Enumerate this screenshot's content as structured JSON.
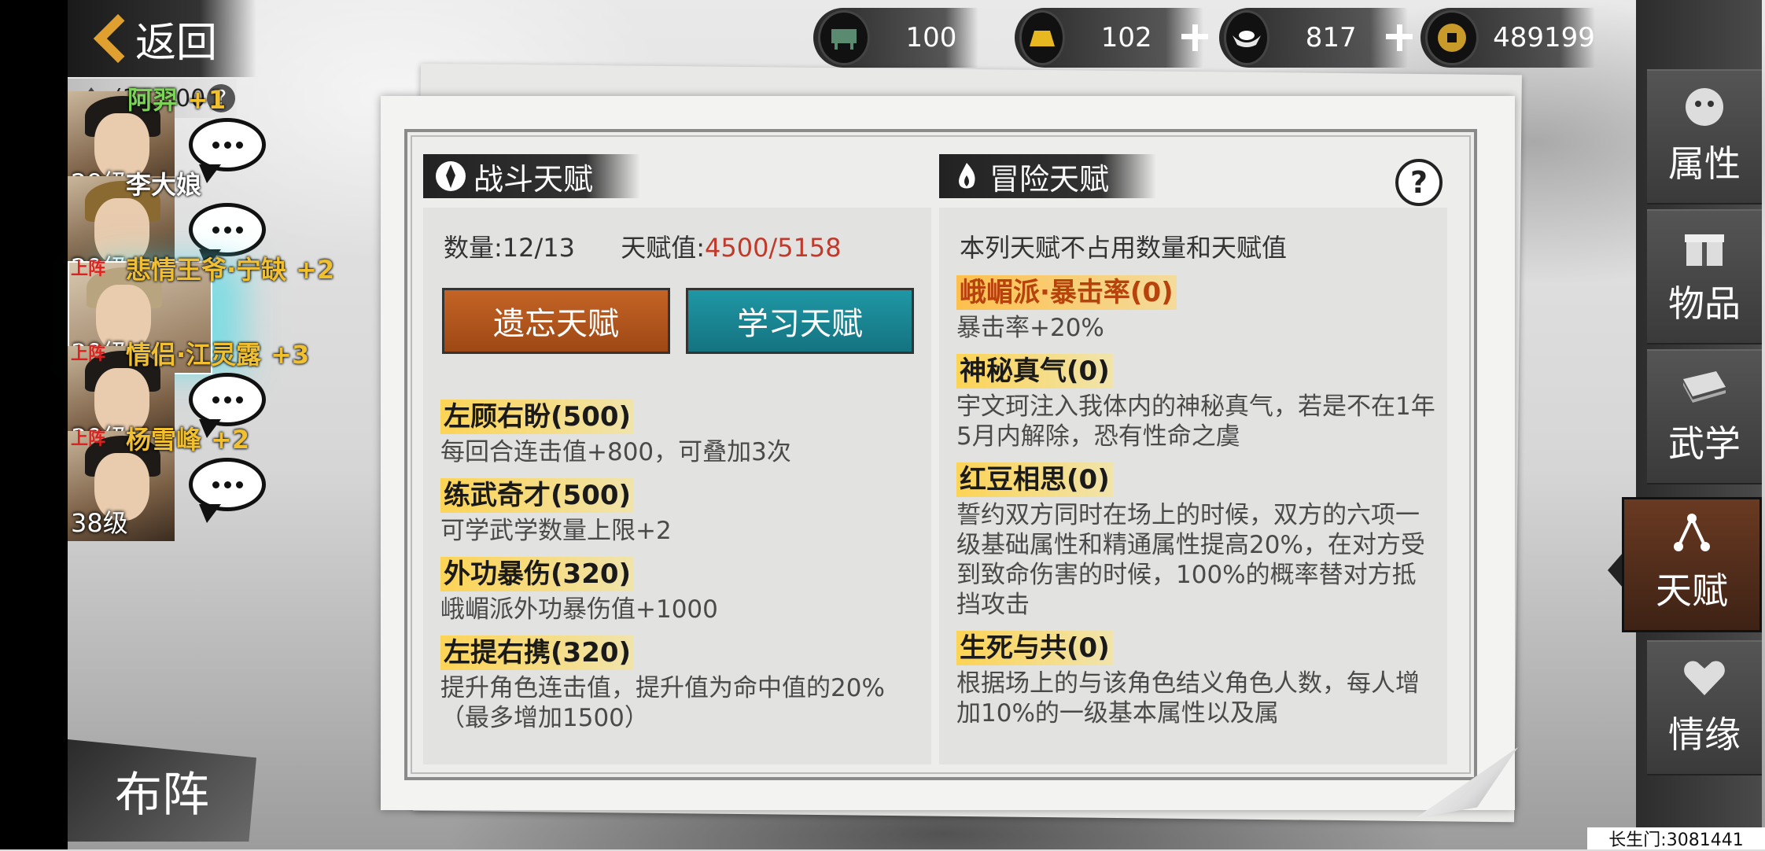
{
  "back": {
    "label": "返回"
  },
  "team": {
    "count": "(30/100",
    "help": "?"
  },
  "characters": [
    {
      "name": "阿羿",
      "bonus": "+1",
      "level": "29级",
      "onstage": "",
      "name_color": "#7dd35a"
    },
    {
      "name": "李大娘",
      "bonus": "",
      "level": "29级",
      "onstage": "",
      "name_color": "#ffffff"
    },
    {
      "name": "悲情王爷·宁缺",
      "bonus": "+2",
      "level": "39级",
      "onstage": "上阵",
      "name_color": "#f0c030"
    },
    {
      "name": "情侣·江灵露",
      "bonus": "+3",
      "level": "39级",
      "onstage": "上阵",
      "name_color": "#f0c030"
    },
    {
      "name": "杨雪峰",
      "bonus": "+2",
      "level": "38级",
      "onstage": "上阵",
      "name_color": "#f0c030"
    }
  ],
  "formation": {
    "label": "布阵"
  },
  "currencies": [
    {
      "icon": "bronze-ding-icon",
      "value": "100"
    },
    {
      "icon": "gold-bar-icon",
      "value": "102"
    },
    {
      "icon": "silver-ingot-icon",
      "value": "817"
    },
    {
      "icon": "copper-coin-icon",
      "value": "489199"
    }
  ],
  "combat": {
    "title": "战斗天赋",
    "count_label": "数量:12/13",
    "value_label": "天赋值:",
    "value": "4500/5158",
    "forget_button": "遗忘天赋",
    "learn_button": "学习天赋",
    "talents": [
      {
        "name": "左顾右盼(500)",
        "desc": "每回合连击值+800，可叠加3次"
      },
      {
        "name": "练武奇才(500)",
        "desc": "可学武学数量上限+2"
      },
      {
        "name": "外功暴伤(320)",
        "desc": "峨嵋派外功暴伤值+1000"
      },
      {
        "name": "左提右携(320)",
        "desc": "提升角色连击值，提升值为命中值的20%（最多增加1500）"
      }
    ]
  },
  "adventure": {
    "title": "冒险天赋",
    "note": "本列天赋不占用数量和天赋值",
    "talents": [
      {
        "name": "峨嵋派·暴击率(0)",
        "desc": "暴击率+20%"
      },
      {
        "name": "神秘真气(0)",
        "desc": "宇文珂注入我体内的神秘真气，若是不在1年5月内解除，恐有性命之虞"
      },
      {
        "name": "红豆相思(0)",
        "desc": "誓约双方同时在场上的时候，双方的六项一级基础属性和精通属性提高20%，在对方受到致命伤害的时候，100%的概率替对方抵挡攻击"
      },
      {
        "name": "生死与共(0)",
        "desc": "根据场上的与该角色结义角色人数，每人增加10%的一级基本属性以及属"
      }
    ]
  },
  "nav": [
    {
      "label": "属性",
      "icon": "tiger-head-icon"
    },
    {
      "label": "物品",
      "icon": "gift-box-icon"
    },
    {
      "label": "武学",
      "icon": "book-icon"
    },
    {
      "label": "天赋",
      "icon": "talent-node-icon"
    },
    {
      "label": "情缘",
      "icon": "heart-knot-icon"
    }
  ],
  "server": {
    "label": "长生门:3081441"
  },
  "colors": {
    "forget": "#c46426",
    "learn": "#1f97a5",
    "value_red": "#c0392b"
  }
}
